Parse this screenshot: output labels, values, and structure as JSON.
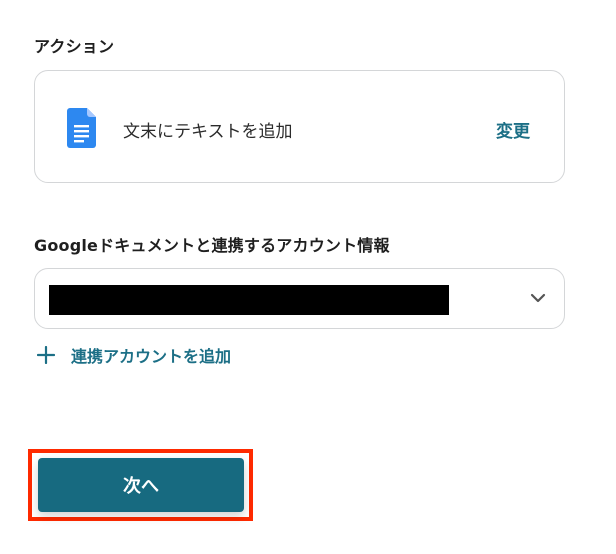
{
  "action_section": {
    "label": "アクション",
    "action_text": "文末にテキストを追加",
    "change_label": "変更",
    "app_icon": "google-docs-icon"
  },
  "account_section": {
    "label": "Googleドキュメントと連携するアカウント情報",
    "selected_value": "",
    "add_account_label": "連携アカウントを追加"
  },
  "footer": {
    "next_label": "次へ"
  },
  "colors": {
    "accent": "#176a80",
    "link": "#1c6f86",
    "highlight": "#ff2a00",
    "docs_blue": "#2d88f0"
  }
}
